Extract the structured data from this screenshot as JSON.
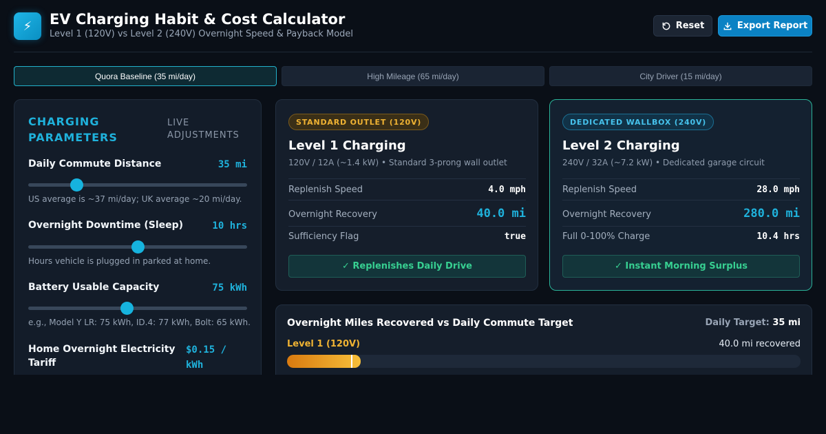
{
  "header": {
    "logo_icon": "bolt-icon",
    "title": "EV Charging Habit & Cost Calculator",
    "subtitle": "Level 1 (120V) vs Level 2 (240V) Overnight Speed & Payback Model",
    "reset_label": "Reset",
    "export_label": "Export Report"
  },
  "tabs": [
    {
      "label": "Quora Baseline (35 mi/day)",
      "active": true
    },
    {
      "label": "High Mileage (65 mi/day)",
      "active": false
    },
    {
      "label": "City Driver (15 mi/day)",
      "active": false
    }
  ],
  "params": {
    "title": "CHARGING PARAMETERS",
    "live_label": "LIVE ADJUSTMENTS",
    "items": [
      {
        "label": "Daily Commute Distance",
        "value": "35 mi",
        "level": 0.22,
        "hint": "US average is ~37 mi/day; UK average ~20 mi/day."
      },
      {
        "label": "Overnight Downtime (Sleep)",
        "value": "10 hrs",
        "level": 0.5,
        "hint": "Hours vehicle is plugged in parked at home."
      },
      {
        "label": "Battery Usable Capacity",
        "value": "75 kWh",
        "level": 0.45,
        "hint": "e.g., Model Y LR: 75 kWh, ID.4: 77 kWh, Bolt: 65 kWh."
      },
      {
        "label": "Home Overnight Electricity Tariff",
        "value": "$0.15 / kWh"
      }
    ]
  },
  "level1": {
    "badge": "STANDARD OUTLET (120V)",
    "title": "Level 1 Charging",
    "subtitle": "120V / 12A (~1.4 kW) • Standard 3-prong wall outlet",
    "rows": [
      {
        "label": "Replenish Speed",
        "value": "4.0 mph"
      },
      {
        "label": "Overnight Recovery",
        "value": "40.0 mi"
      },
      {
        "label": "Sufficiency Flag",
        "value": "true"
      }
    ],
    "status": "✓ Replenishes Daily Drive"
  },
  "level2": {
    "badge": "DEDICATED WALLBOX (240V)",
    "title": "Level 2 Charging",
    "subtitle": "240V / 32A (~7.2 kW) • Dedicated garage circuit",
    "rows": [
      {
        "label": "Replenish Speed",
        "value": "28.0 mph"
      },
      {
        "label": "Overnight Recovery",
        "value": "280.0 mi"
      },
      {
        "label": "Full 0-100% Charge",
        "value": "10.4 hrs"
      }
    ],
    "status": "✓ Instant Morning Surplus"
  },
  "miles_chart": {
    "title": "Overnight Miles Recovered vs Daily Commute Target",
    "target_label": "Daily Target:",
    "target_value": "35 mi",
    "bars": [
      {
        "label": "Level 1 (120V)",
        "note": "40.0 mi recovered",
        "value": 40.0,
        "target": 35,
        "max": 280
      }
    ]
  },
  "colors": {
    "accent": "#1fb2dc",
    "level1": "#f0b333",
    "level2": "#46c2ec",
    "success": "#37cf91"
  }
}
